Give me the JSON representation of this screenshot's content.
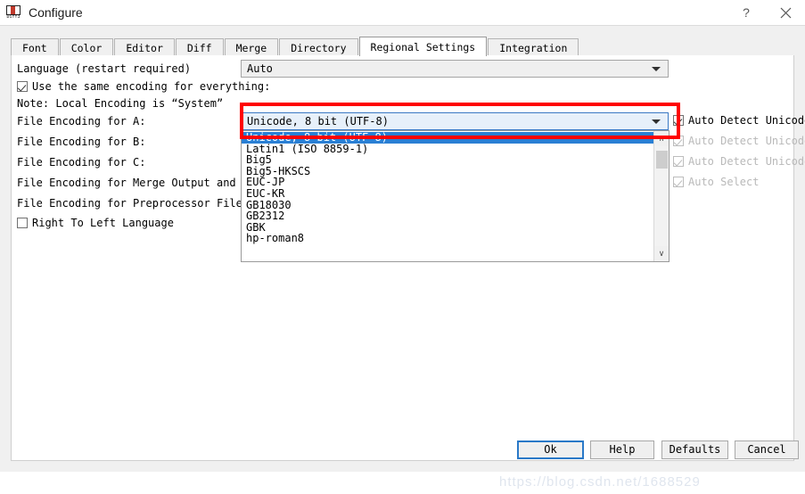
{
  "window": {
    "title": "Configure",
    "icon_name": "kdiff3-icon",
    "icon_label": "Diff3",
    "help_button": "?",
    "close_button": "✕"
  },
  "tabs": [
    {
      "label": "Font",
      "active": false
    },
    {
      "label": "Color",
      "active": false
    },
    {
      "label": "Editor",
      "active": false
    },
    {
      "label": "Diff",
      "active": false
    },
    {
      "label": "Merge",
      "active": false
    },
    {
      "label": "Directory",
      "active": false
    },
    {
      "label": "Regional Settings",
      "active": true
    },
    {
      "label": "Integration",
      "active": false
    }
  ],
  "form": {
    "language_label": "Language (restart required)",
    "language_value": "Auto",
    "same_encoding_label": "Use the same encoding for everything:",
    "same_encoding_checked": true,
    "note_label": "Note: Local Encoding is “System”",
    "encoding_a_label": "File Encoding for A:",
    "encoding_b_label": "File Encoding for B:",
    "encoding_c_label": "File Encoding for C:",
    "encoding_merge_label": "File Encoding for Merge Output and Saving:",
    "encoding_preprocessor_label": "File Encoding for Preprocessor Files:",
    "rtl_label": "Right To Left Language",
    "rtl_checked": false,
    "encoding_a_value": "Unicode, 8 bit (UTF-8)"
  },
  "right_checks": [
    {
      "label": "Auto Detect Unicode",
      "checked": true,
      "dim": false
    },
    {
      "label": "Auto Detect Unicode",
      "checked": true,
      "dim": true
    },
    {
      "label": "Auto Detect Unicode",
      "checked": true,
      "dim": true
    },
    {
      "label": "Auto Select",
      "checked": true,
      "dim": true
    }
  ],
  "dropdown": {
    "selected": "Unicode, 8 bit (UTF-8)",
    "items": [
      "Unicode, 8 bit (UTF-8)",
      "Latin1 (ISO 8859-1)",
      "Big5",
      "Big5-HKSCS",
      "EUC-JP",
      "EUC-KR",
      "GB18030",
      "GB2312",
      "GBK",
      "hp-roman8"
    ],
    "scroll_up_icon": "∧",
    "scroll_down_icon": "∨"
  },
  "buttons": [
    {
      "label": "Ok",
      "default": true
    },
    {
      "label": "Help",
      "default": false
    },
    {
      "label": "Defaults",
      "default": false
    },
    {
      "label": "Cancel",
      "default": false
    }
  ],
  "watermark": "https://blog.csdn.net/1688529",
  "colors": {
    "annotation": "#ff0000",
    "selection": "#2a7fd4",
    "focus": "#2a79c8",
    "dialog_bg": "#f0f0f0"
  }
}
